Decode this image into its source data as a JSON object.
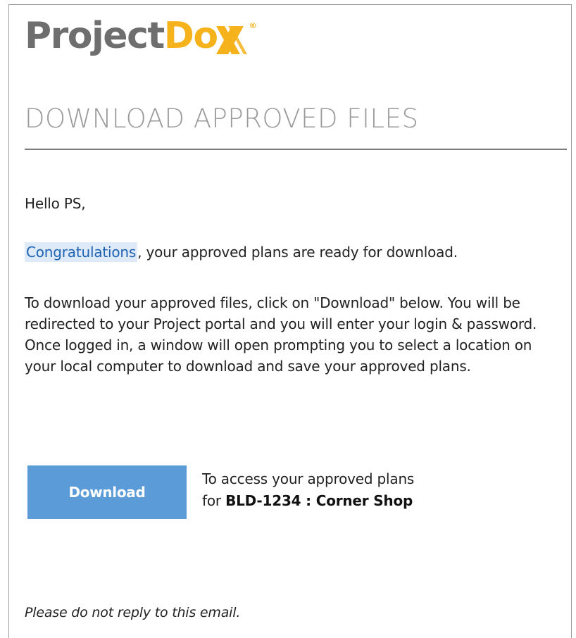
{
  "brand": {
    "logo_part1": "Project",
    "logo_part2": "Do",
    "logo_reg": "®",
    "colors": {
      "gray": "#6e6e6e",
      "accent": "#f5b21b"
    }
  },
  "email": {
    "title": "DOWNLOAD APPROVED FILES",
    "greeting": "Hello PS,",
    "congrats_highlight": "Congratulations",
    "congrats_rest": ", your approved plans are ready for download.",
    "instructions": "To download your approved files, click on \"Download\" below. You will be redirected to your Project portal and you will enter your login & password. Once logged in, a window will open prompting you to select a location on your local computer to download and save your approved plans.",
    "download_button": "Download",
    "access_line1": "To access your approved plans",
    "access_for": "for ",
    "project_ref": "BLD-1234 : Corner Shop",
    "footer": "Please do not reply to this email."
  },
  "colors": {
    "button_bg": "#5b9bd7",
    "title_gray": "#9a9a9a",
    "highlight_bg": "#dfeaf8",
    "link_blue": "#1d63b3"
  }
}
